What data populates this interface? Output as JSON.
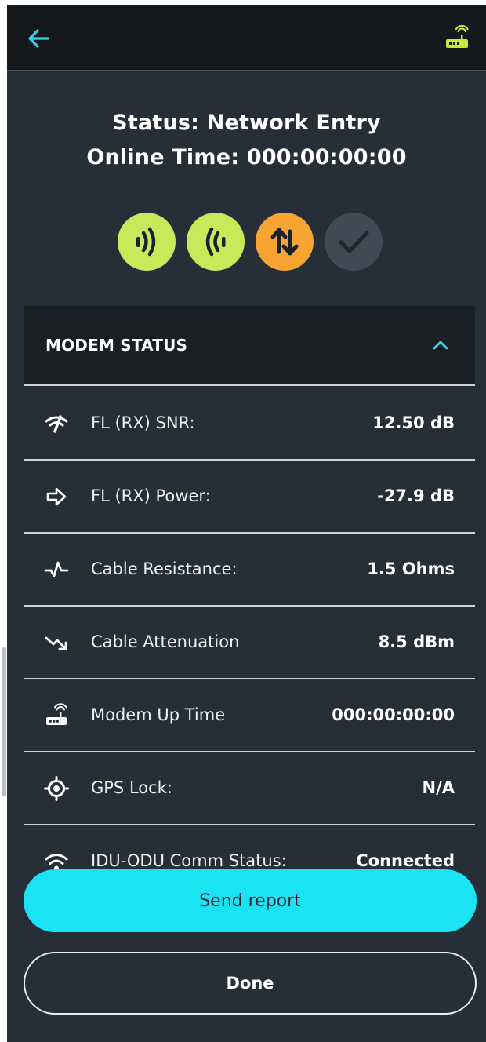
{
  "header": {
    "back_icon": "arrow-left-icon",
    "modem_icon": "modem-icon",
    "accent_color": "#3fd0f0",
    "modem_icon_color": "#c8e63c"
  },
  "status": {
    "status_line": "Status: Network Entry",
    "online_line": "Online Time: 000:00:00:00"
  },
  "indicators": [
    {
      "name": "transmit-signal-icon",
      "color": "#c9e85a",
      "state": "ok"
    },
    {
      "name": "receive-signal-icon",
      "color": "#c9e85a",
      "state": "ok"
    },
    {
      "name": "up-down-arrows-icon",
      "color": "#f7a530",
      "state": "in-progress"
    },
    {
      "name": "checkmark-icon",
      "color": "#3e4a55",
      "state": "inactive"
    }
  ],
  "modem_status": {
    "title": "MODEM STATUS",
    "expanded": true,
    "rows": [
      {
        "icon": "signal-quality-icon",
        "label": "FL (RX) SNR:",
        "value": "12.50 dB"
      },
      {
        "icon": "arrow-right-icon",
        "label": "FL (RX) Power:",
        "value": "-27.9 dB"
      },
      {
        "icon": "pulse-icon",
        "label": "Cable Resistance:",
        "value": "1.5 Ohms"
      },
      {
        "icon": "trend-down-icon",
        "label": "Cable Attenuation",
        "value": "8.5 dBm"
      },
      {
        "icon": "modem-icon",
        "label": "Modem Up Time",
        "value": "000:00:00:00"
      },
      {
        "icon": "crosshair-icon",
        "label": "GPS Lock:",
        "value": "N/A"
      },
      {
        "icon": "wifi-icon",
        "label": "IDU-ODU Comm Status:",
        "value": "Connected"
      }
    ]
  },
  "actions": {
    "send_label": "Send report",
    "done_label": "Done",
    "send_color": "#1ce3f3"
  }
}
